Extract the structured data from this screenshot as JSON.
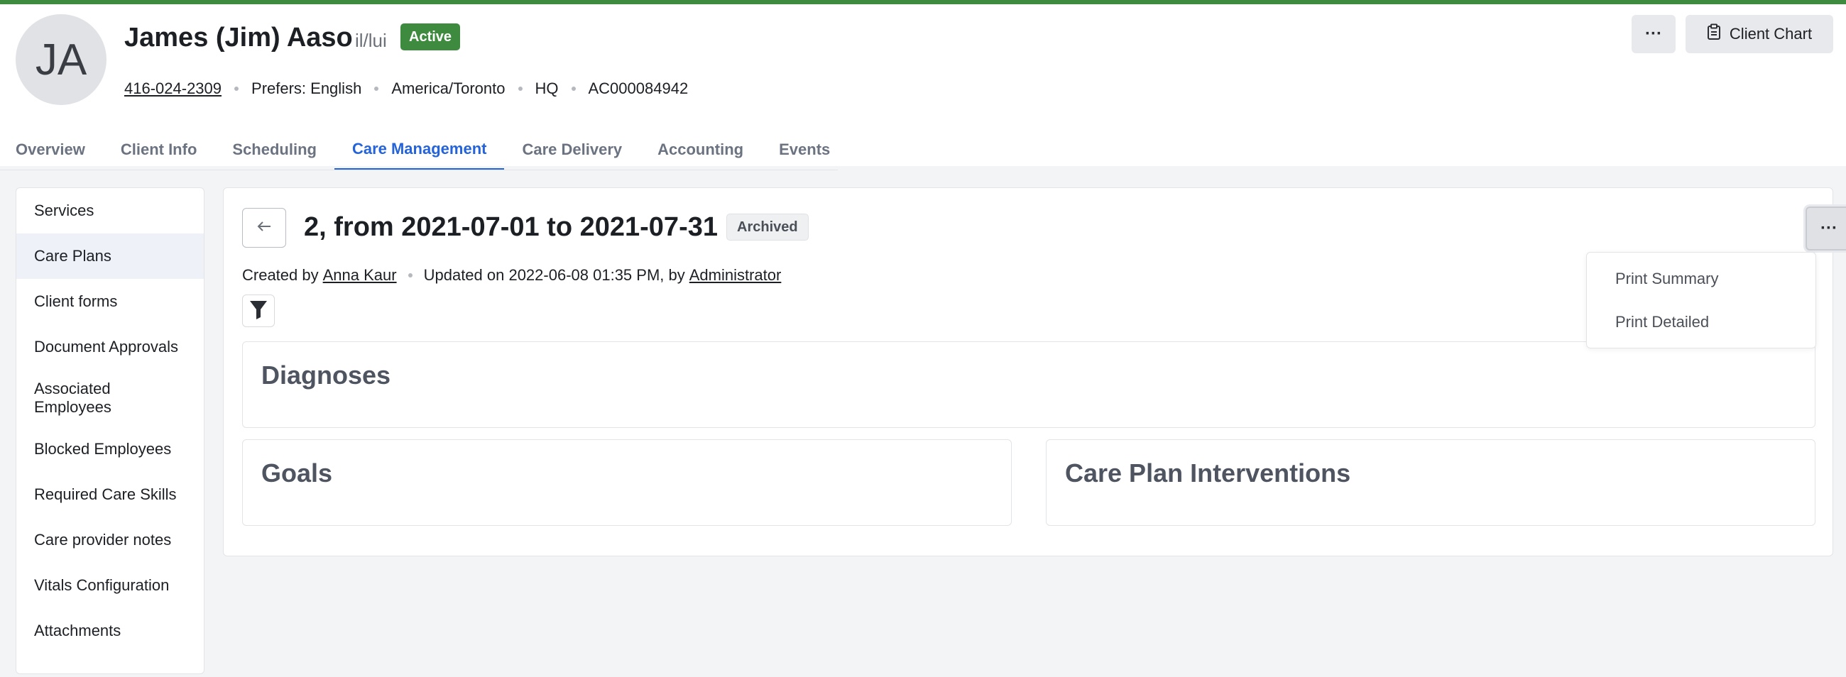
{
  "client": {
    "initials": "JA",
    "name": "James (Jim) Aaso",
    "pronouns": "il/lui",
    "status": "Active",
    "phone": "416-024-2309",
    "language": "Prefers: English",
    "timezone": "America/Toronto",
    "branch": "HQ",
    "account_id": "AC000084942"
  },
  "header_actions": {
    "more_label": "···",
    "client_chart_label": "Client Chart"
  },
  "tabs": [
    {
      "label": "Overview",
      "active": false
    },
    {
      "label": "Client Info",
      "active": false
    },
    {
      "label": "Scheduling",
      "active": false
    },
    {
      "label": "Care Management",
      "active": true
    },
    {
      "label": "Care Delivery",
      "active": false
    },
    {
      "label": "Accounting",
      "active": false
    },
    {
      "label": "Events",
      "active": false
    }
  ],
  "sidebar": {
    "items": [
      {
        "label": "Services"
      },
      {
        "label": "Care Plans",
        "active": true
      },
      {
        "label": "Client forms"
      },
      {
        "label": "Document Approvals"
      },
      {
        "label": "Associated Employees"
      },
      {
        "label": "Blocked Employees"
      },
      {
        "label": "Required Care Skills"
      },
      {
        "label": "Care provider notes"
      },
      {
        "label": "Vitals Configuration"
      },
      {
        "label": "Attachments"
      }
    ]
  },
  "care_plan": {
    "title": "2, from 2021-07-01 to 2021-07-31",
    "status": "Archived",
    "created_by_prefix": "Created by",
    "created_by": "Anna Kaur",
    "updated_text": "Updated on 2022-06-08 01:35 PM, by",
    "updated_by": "Administrator",
    "more_label": "···",
    "sections": {
      "diagnoses": "Diagnoses",
      "goals": "Goals",
      "interventions": "Care Plan Interventions"
    },
    "menu": {
      "print_summary": "Print Summary",
      "print_detailed": "Print Detailed"
    }
  },
  "colors": {
    "accent_green": "#3e8a3e",
    "active_tab_blue": "#2463d9"
  }
}
